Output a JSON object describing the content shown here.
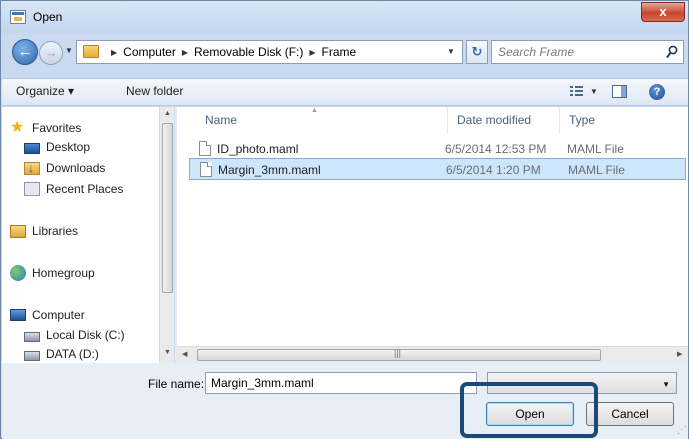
{
  "window": {
    "title": "Open",
    "close_label": "x"
  },
  "navigation": {
    "back_icon": "back-arrow-icon",
    "forward_icon": "forward-arrow-icon",
    "breadcrumbs": [
      "Computer",
      "Removable Disk (F:)",
      "Frame"
    ],
    "search_placeholder": "Search Frame"
  },
  "toolbar": {
    "organize_label": "Organize ▾",
    "new_folder_label": "New folder",
    "help_label": "?"
  },
  "sidebar": {
    "items": [
      {
        "label": "Favorites",
        "icon": "star-icon"
      },
      {
        "label": "Desktop",
        "icon": "desktop-icon"
      },
      {
        "label": "Downloads",
        "icon": "downloads-icon"
      },
      {
        "label": "Recent Places",
        "icon": "recent-places-icon"
      },
      {
        "label": "Libraries",
        "icon": "libraries-icon"
      },
      {
        "label": "Homegroup",
        "icon": "homegroup-icon"
      },
      {
        "label": "Computer",
        "icon": "computer-icon"
      },
      {
        "label": "Local Disk (C:)",
        "icon": "disk-icon"
      },
      {
        "label": "DATA (D:)",
        "icon": "disk-icon"
      }
    ]
  },
  "file_list": {
    "columns": [
      "Name",
      "Date modified",
      "Type"
    ],
    "rows": [
      {
        "name": "ID_photo.maml",
        "date": "6/5/2014 12:53 PM",
        "type": "MAML File",
        "selected": false
      },
      {
        "name": "Margin_3mm.maml",
        "date": "6/5/2014 1:20 PM",
        "type": "MAML File",
        "selected": true
      }
    ]
  },
  "bottom": {
    "file_name_label": "File name:",
    "file_name_value": "Margin_3mm.maml",
    "open_label": "Open",
    "cancel_label": "Cancel"
  },
  "colors": {
    "selection": "#cde6fd",
    "highlight_box": "#1c4a77"
  }
}
